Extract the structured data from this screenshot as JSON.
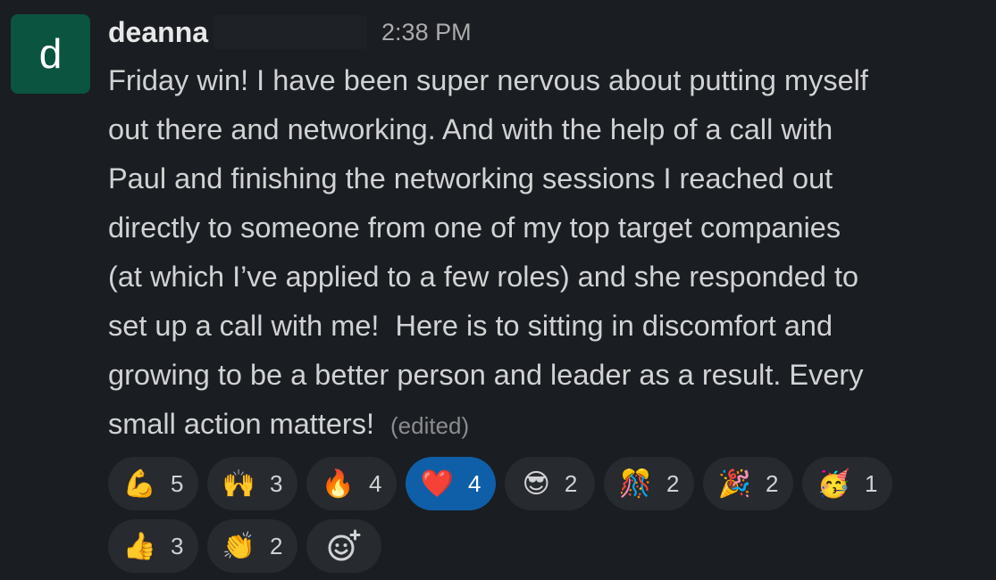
{
  "message": {
    "avatar_letter": "d",
    "avatar_color": "#0b5440",
    "username": "deanna",
    "timestamp": "2:38 PM",
    "lines": [
      "Friday win! I have been super nervous about putting myself",
      "out there and networking. And with the help of a call with",
      "Paul and finishing the networking sessions I reached out",
      "directly to someone from one of my top target companies",
      "(at which I’ve applied to a few roles) and she responded to",
      "set up a call with me!  Here is to sitting in discomfort and",
      "growing to be a better person and leader as a result. Every",
      "small action matters!"
    ],
    "edited_label": "(edited)"
  },
  "reactions": [
    {
      "emoji": "💪",
      "icon": "flexed-biceps-icon",
      "count": "5",
      "selected": false
    },
    {
      "emoji": "🙌",
      "icon": "raising-hands-icon",
      "count": "3",
      "selected": false
    },
    {
      "emoji": "🔥",
      "icon": "fire-icon",
      "count": "4",
      "selected": false
    },
    {
      "emoji": "❤️",
      "icon": "red-heart-icon",
      "count": "4",
      "selected": true
    },
    {
      "emoji": "😎",
      "icon": "sunglasses-face-icon",
      "count": "2",
      "selected": false
    },
    {
      "emoji": "🎊",
      "icon": "confetti-ball-icon",
      "count": "2",
      "selected": false
    },
    {
      "emoji": "🎉",
      "icon": "party-popper-icon",
      "count": "2",
      "selected": false
    },
    {
      "emoji": "🥳",
      "icon": "partying-face-icon",
      "count": "1",
      "selected": false
    },
    {
      "emoji": "👍",
      "icon": "thumbs-up-icon",
      "count": "3",
      "selected": false
    },
    {
      "emoji": "👏",
      "icon": "clapping-hands-icon",
      "count": "2",
      "selected": false
    }
  ],
  "add_reaction_icon": "add-reaction-icon",
  "colors": {
    "background": "#1a1d21",
    "pill": "#272a2f",
    "selected_pill": "#0f5fa8"
  }
}
